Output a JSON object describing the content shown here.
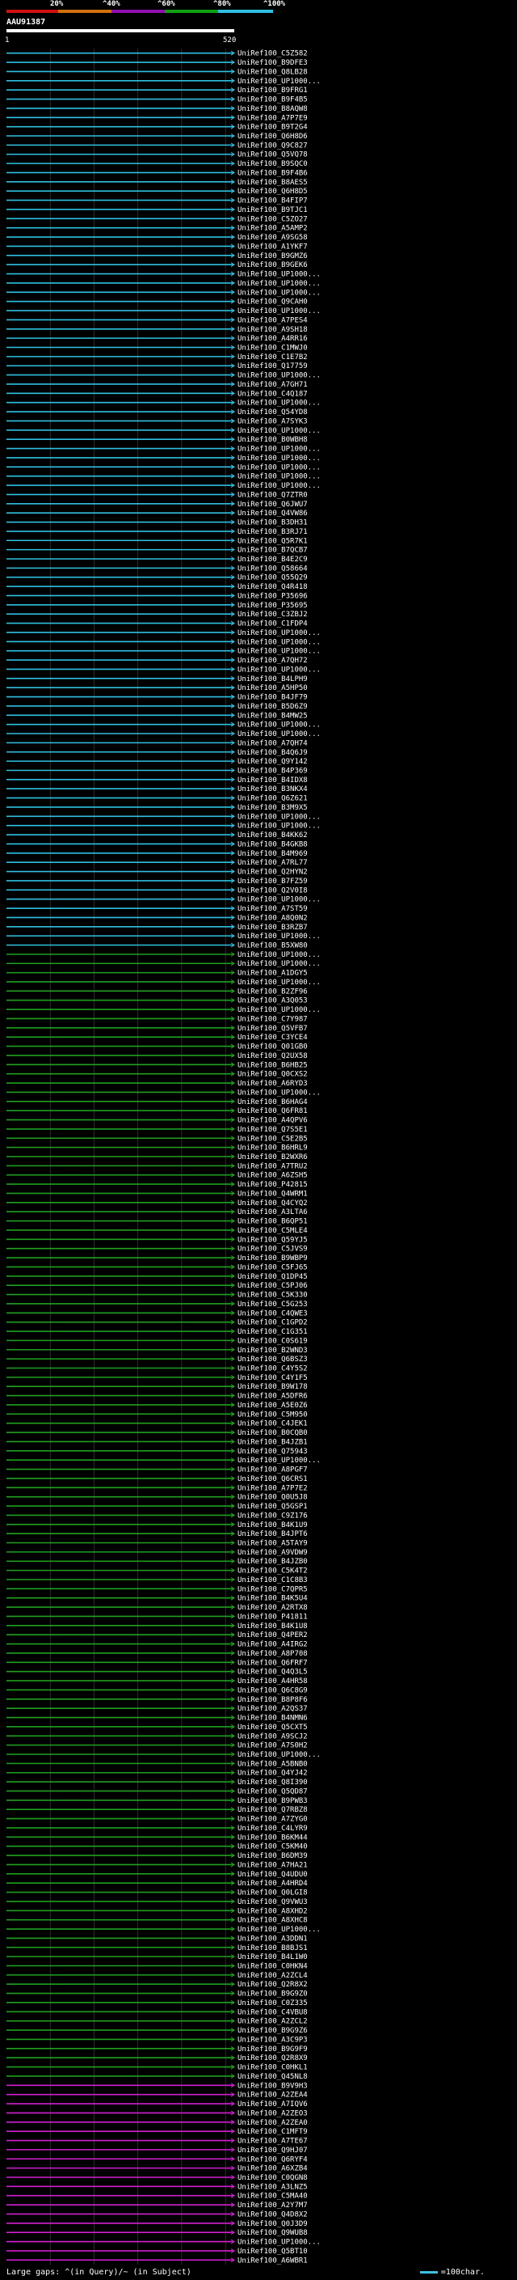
{
  "legend": {
    "ticks": [
      "20%",
      "^40%",
      "^60%",
      "^80%",
      "^100%"
    ],
    "colors": [
      "#d01010",
      "#d07010",
      "#9010b0",
      "#10a010",
      "#30c0e0"
    ]
  },
  "query": {
    "name": "AAU91387",
    "ruler_start": "1",
    "ruler_end": "520"
  },
  "footer": {
    "gaps": "Large gaps: ^(in Query)/~ (in Subject)",
    "scale": "=100char."
  },
  "chart_data": {
    "type": "alignment",
    "title": "AAU91387",
    "query_length": 520,
    "hits": [
      {
        "id": "UniRef100_C5Z582",
        "group": "cyan"
      },
      {
        "id": "UniRef100_B9DFE3",
        "group": "cyan"
      },
      {
        "id": "UniRef100_Q8LB28",
        "group": "cyan"
      },
      {
        "id": "UniRef100_UP1000...",
        "group": "cyan"
      },
      {
        "id": "UniRef100_B9FRG1",
        "group": "cyan"
      },
      {
        "id": "UniRef100_B9F4B5",
        "group": "cyan"
      },
      {
        "id": "UniRef100_B8AQW8",
        "group": "cyan"
      },
      {
        "id": "UniRef100_A7P7E9",
        "group": "cyan"
      },
      {
        "id": "UniRef100_B9T2G4",
        "group": "cyan"
      },
      {
        "id": "UniRef100_Q6H8D6",
        "group": "cyan"
      },
      {
        "id": "UniRef100_Q9C827",
        "group": "cyan"
      },
      {
        "id": "UniRef100_Q5VQ78",
        "group": "cyan"
      },
      {
        "id": "UniRef100_B9SQC0",
        "group": "cyan"
      },
      {
        "id": "UniRef100_B9F4B6",
        "group": "cyan"
      },
      {
        "id": "UniRef100_B8AES5",
        "group": "cyan"
      },
      {
        "id": "UniRef100_Q6H8D5",
        "group": "cyan"
      },
      {
        "id": "UniRef100_B4FIP7",
        "group": "cyan"
      },
      {
        "id": "UniRef100_B9TJC1",
        "group": "cyan"
      },
      {
        "id": "UniRef100_C5ZO27",
        "group": "cyan"
      },
      {
        "id": "UniRef100_A5AMP2",
        "group": "cyan"
      },
      {
        "id": "UniRef100_A9SG58",
        "group": "cyan"
      },
      {
        "id": "UniRef100_A1YKF7",
        "group": "cyan"
      },
      {
        "id": "UniRef100_B9GMZ6",
        "group": "cyan"
      },
      {
        "id": "UniRef100_B9GEK6",
        "group": "cyan"
      },
      {
        "id": "UniRef100_UP1000...",
        "group": "cyan"
      },
      {
        "id": "UniRef100_UP1000...",
        "group": "cyan"
      },
      {
        "id": "UniRef100_UP1000...",
        "group": "cyan"
      },
      {
        "id": "UniRef100_Q9CAH0",
        "group": "cyan"
      },
      {
        "id": "UniRef100_UP1000...",
        "group": "cyan"
      },
      {
        "id": "UniRef100_A7PES4",
        "group": "cyan"
      },
      {
        "id": "UniRef100_A9SH18",
        "group": "cyan"
      },
      {
        "id": "UniRef100_A4RR16",
        "group": "cyan"
      },
      {
        "id": "UniRef100_C1MWJ0",
        "group": "cyan"
      },
      {
        "id": "UniRef100_C1E7B2",
        "group": "cyan"
      },
      {
        "id": "UniRef100_Q17759",
        "group": "cyan"
      },
      {
        "id": "UniRef100_UP1000...",
        "group": "cyan"
      },
      {
        "id": "UniRef100_A7GH71",
        "group": "cyan"
      },
      {
        "id": "UniRef100_C4Q187",
        "group": "cyan"
      },
      {
        "id": "UniRef100_UP1000...",
        "group": "cyan"
      },
      {
        "id": "UniRef100_Q54YD8",
        "group": "cyan"
      },
      {
        "id": "UniRef100_A7SYK3",
        "group": "cyan"
      },
      {
        "id": "UniRef100_UP1000...",
        "group": "cyan"
      },
      {
        "id": "UniRef100_B0WBH8",
        "group": "cyan"
      },
      {
        "id": "UniRef100_UP1000...",
        "group": "cyan"
      },
      {
        "id": "UniRef100_UP1000...",
        "group": "cyan"
      },
      {
        "id": "UniRef100_UP1000...",
        "group": "cyan"
      },
      {
        "id": "UniRef100_UP1000...",
        "group": "cyan"
      },
      {
        "id": "UniRef100_UP1000...",
        "group": "cyan"
      },
      {
        "id": "UniRef100_Q7ZTR0",
        "group": "cyan"
      },
      {
        "id": "UniRef100_Q6JWU7",
        "group": "cyan"
      },
      {
        "id": "UniRef100_Q4VW86",
        "group": "cyan"
      },
      {
        "id": "UniRef100_B3DH31",
        "group": "cyan"
      },
      {
        "id": "UniRef100_B3RJ71",
        "group": "cyan"
      },
      {
        "id": "UniRef100_Q5R7K1",
        "group": "cyan"
      },
      {
        "id": "UniRef100_B7QCB7",
        "group": "cyan"
      },
      {
        "id": "UniRef100_B4E2C9",
        "group": "cyan"
      },
      {
        "id": "UniRef100_Q58664",
        "group": "cyan"
      },
      {
        "id": "UniRef100_Q55Q29",
        "group": "cyan"
      },
      {
        "id": "UniRef100_Q4R418",
        "group": "cyan"
      },
      {
        "id": "UniRef100_P35696",
        "group": "cyan"
      },
      {
        "id": "UniRef100_P35695",
        "group": "cyan"
      },
      {
        "id": "UniRef100_C3ZBJ2",
        "group": "cyan"
      },
      {
        "id": "UniRef100_C1FDP4",
        "group": "cyan"
      },
      {
        "id": "UniRef100_UP1000...",
        "group": "cyan"
      },
      {
        "id": "UniRef100_UP1000...",
        "group": "cyan"
      },
      {
        "id": "UniRef100_UP1000...",
        "group": "cyan"
      },
      {
        "id": "UniRef100_A7QH72",
        "group": "cyan"
      },
      {
        "id": "UniRef100_UP1000...",
        "group": "cyan"
      },
      {
        "id": "UniRef100_B4LPH9",
        "group": "cyan"
      },
      {
        "id": "UniRef100_A5HP50",
        "group": "cyan"
      },
      {
        "id": "UniRef100_B4JF79",
        "group": "cyan"
      },
      {
        "id": "UniRef100_B5D6Z9",
        "group": "cyan"
      },
      {
        "id": "UniRef100_B4MW25",
        "group": "cyan"
      },
      {
        "id": "UniRef100_UP1000...",
        "group": "cyan"
      },
      {
        "id": "UniRef100_UP1000...",
        "group": "cyan"
      },
      {
        "id": "UniRef100_A7QH74",
        "group": "cyan"
      },
      {
        "id": "UniRef100_B4Q6J9",
        "group": "cyan"
      },
      {
        "id": "UniRef100_Q9Y142",
        "group": "cyan"
      },
      {
        "id": "UniRef100_B4P369",
        "group": "cyan"
      },
      {
        "id": "UniRef100_B4IDX8",
        "group": "cyan"
      },
      {
        "id": "UniRef100_B3NKX4",
        "group": "cyan"
      },
      {
        "id": "UniRef100_Q6Z621",
        "group": "cyan"
      },
      {
        "id": "UniRef100_B3M9X5",
        "group": "cyan"
      },
      {
        "id": "UniRef100_UP1000...",
        "group": "cyan"
      },
      {
        "id": "UniRef100_UP1000...",
        "group": "cyan"
      },
      {
        "id": "UniRef100_B4KK62",
        "group": "cyan"
      },
      {
        "id": "UniRef100_B4GKB8",
        "group": "cyan"
      },
      {
        "id": "UniRef100_B4M969",
        "group": "cyan"
      },
      {
        "id": "UniRef100_A7RL77",
        "group": "cyan"
      },
      {
        "id": "UniRef100_Q2HYN2",
        "group": "cyan"
      },
      {
        "id": "UniRef100_B7FZ59",
        "group": "cyan"
      },
      {
        "id": "UniRef100_Q2V0I8",
        "group": "cyan"
      },
      {
        "id": "UniRef100_UP1000...",
        "group": "cyan"
      },
      {
        "id": "UniRef100_A7ST59",
        "group": "cyan"
      },
      {
        "id": "UniRef100_A8Q0N2",
        "group": "cyan"
      },
      {
        "id": "UniRef100_B3RZB7",
        "group": "cyan"
      },
      {
        "id": "UniRef100_UP1000...",
        "group": "cyan"
      },
      {
        "id": "UniRef100_B5XW80",
        "group": "cyan"
      },
      {
        "id": "UniRef100_UP1000...",
        "group": "green"
      },
      {
        "id": "UniRef100_UP1000...",
        "group": "green"
      },
      {
        "id": "UniRef100_A1DGY5",
        "group": "green"
      },
      {
        "id": "UniRef100_UP1000...",
        "group": "green"
      },
      {
        "id": "UniRef100_B2ZF96",
        "group": "green"
      },
      {
        "id": "UniRef100_A3Q053",
        "group": "green"
      },
      {
        "id": "UniRef100_UP1000...",
        "group": "green"
      },
      {
        "id": "UniRef100_C7Y987",
        "group": "green"
      },
      {
        "id": "UniRef100_Q5VFB7",
        "group": "green"
      },
      {
        "id": "UniRef100_C3YCE4",
        "group": "green"
      },
      {
        "id": "UniRef100_Q01GB0",
        "group": "green"
      },
      {
        "id": "UniRef100_Q2UX58",
        "group": "green"
      },
      {
        "id": "UniRef100_B6HB25",
        "group": "green"
      },
      {
        "id": "UniRef100_Q0CXS2",
        "group": "green"
      },
      {
        "id": "UniRef100_A6RYD3",
        "group": "green"
      },
      {
        "id": "UniRef100_UP1000...",
        "group": "green"
      },
      {
        "id": "UniRef100_B6HAG4",
        "group": "green"
      },
      {
        "id": "UniRef100_Q6FR81",
        "group": "green"
      },
      {
        "id": "UniRef100_A4QPV6",
        "group": "green"
      },
      {
        "id": "UniRef100_Q7S5E1",
        "group": "green"
      },
      {
        "id": "UniRef100_C5E2B5",
        "group": "green"
      },
      {
        "id": "UniRef100_B6HRL9",
        "group": "green"
      },
      {
        "id": "UniRef100_B2WXR6",
        "group": "green"
      },
      {
        "id": "UniRef100_A7TRU2",
        "group": "green"
      },
      {
        "id": "UniRef100_A6ZSH5",
        "group": "green"
      },
      {
        "id": "UniRef100_P42815",
        "group": "green"
      },
      {
        "id": "UniRef100_Q4WRM1",
        "group": "green"
      },
      {
        "id": "UniRef100_Q4CYQ2",
        "group": "green"
      },
      {
        "id": "UniRef100_A3LTA6",
        "group": "green"
      },
      {
        "id": "UniRef100_B6QP51",
        "group": "green"
      },
      {
        "id": "UniRef100_C5MLE4",
        "group": "green"
      },
      {
        "id": "UniRef100_Q59YJ5",
        "group": "green"
      },
      {
        "id": "UniRef100_C5JVS9",
        "group": "green"
      },
      {
        "id": "UniRef100_B9WBP9",
        "group": "green"
      },
      {
        "id": "UniRef100_C5FJ65",
        "group": "green"
      },
      {
        "id": "UniRef100_Q1DP45",
        "group": "green"
      },
      {
        "id": "UniRef100_C5PJ06",
        "group": "green"
      },
      {
        "id": "UniRef100_C5K330",
        "group": "green"
      },
      {
        "id": "UniRef100_C5G253",
        "group": "green"
      },
      {
        "id": "UniRef100_C4QWE3",
        "group": "green"
      },
      {
        "id": "UniRef100_C1GPD2",
        "group": "green"
      },
      {
        "id": "UniRef100_C1G351",
        "group": "green"
      },
      {
        "id": "UniRef100_C0S619",
        "group": "green"
      },
      {
        "id": "UniRef100_B2WND3",
        "group": "green"
      },
      {
        "id": "UniRef100_Q6BSZ3",
        "group": "green"
      },
      {
        "id": "UniRef100_C4Y5S2",
        "group": "green"
      },
      {
        "id": "UniRef100_C4Y1F5",
        "group": "green"
      },
      {
        "id": "UniRef100_B9W178",
        "group": "green"
      },
      {
        "id": "UniRef100_A5DFR6",
        "group": "green"
      },
      {
        "id": "UniRef100_A5E0Z6",
        "group": "green"
      },
      {
        "id": "UniRef100_C5M950",
        "group": "green"
      },
      {
        "id": "UniRef100_C4JEK1",
        "group": "green"
      },
      {
        "id": "UniRef100_B0CQB0",
        "group": "green"
      },
      {
        "id": "UniRef100_B4JZB1",
        "group": "green"
      },
      {
        "id": "UniRef100_Q75943",
        "group": "green"
      },
      {
        "id": "UniRef100_UP1000...",
        "group": "green"
      },
      {
        "id": "UniRef100_A8PGF7",
        "group": "green"
      },
      {
        "id": "UniRef100_Q6CRS1",
        "group": "green"
      },
      {
        "id": "UniRef100_A7P7E2",
        "group": "green"
      },
      {
        "id": "UniRef100_Q0U5J8",
        "group": "green"
      },
      {
        "id": "UniRef100_Q5GSP1",
        "group": "green"
      },
      {
        "id": "UniRef100_C9Z176",
        "group": "green"
      },
      {
        "id": "UniRef100_B4K1U9",
        "group": "green"
      },
      {
        "id": "UniRef100_B4JPT6",
        "group": "green"
      },
      {
        "id": "UniRef100_A5TAY9",
        "group": "green"
      },
      {
        "id": "UniRef100_A9VDW9",
        "group": "green"
      },
      {
        "id": "UniRef100_B4JZB0",
        "group": "green"
      },
      {
        "id": "UniRef100_C5K4T2",
        "group": "green"
      },
      {
        "id": "UniRef100_C1C8B3",
        "group": "green"
      },
      {
        "id": "UniRef100_C7QPR5",
        "group": "green"
      },
      {
        "id": "UniRef100_B4K5U4",
        "group": "green"
      },
      {
        "id": "UniRef100_A2RTX8",
        "group": "green"
      },
      {
        "id": "UniRef100_P41811",
        "group": "green"
      },
      {
        "id": "UniRef100_B4K1U8",
        "group": "green"
      },
      {
        "id": "UniRef100_Q4PER2",
        "group": "green"
      },
      {
        "id": "UniRef100_A4IRG2",
        "group": "green"
      },
      {
        "id": "UniRef100_A8P708",
        "group": "green"
      },
      {
        "id": "UniRef100_Q6FRF7",
        "group": "green"
      },
      {
        "id": "UniRef100_Q4Q3L5",
        "group": "green"
      },
      {
        "id": "UniRef100_A4HR58",
        "group": "green"
      },
      {
        "id": "UniRef100_Q6C8G9",
        "group": "green"
      },
      {
        "id": "UniRef100_B8P8F6",
        "group": "green"
      },
      {
        "id": "UniRef100_A2QS37",
        "group": "green"
      },
      {
        "id": "UniRef100_B4NMN6",
        "group": "green"
      },
      {
        "id": "UniRef100_Q5CXT5",
        "group": "green"
      },
      {
        "id": "UniRef100_A9SCJ2",
        "group": "green"
      },
      {
        "id": "UniRef100_A7S0H2",
        "group": "green"
      },
      {
        "id": "UniRef100_UP1000...",
        "group": "green"
      },
      {
        "id": "UniRef100_A5BNB0",
        "group": "green"
      },
      {
        "id": "UniRef100_Q4YJ42",
        "group": "green"
      },
      {
        "id": "UniRef100_Q8I390",
        "group": "green"
      },
      {
        "id": "UniRef100_Q5QD87",
        "group": "green"
      },
      {
        "id": "UniRef100_B9PWB3",
        "group": "green"
      },
      {
        "id": "UniRef100_Q7RBZ8",
        "group": "green"
      },
      {
        "id": "UniRef100_A7ZYG0",
        "group": "green"
      },
      {
        "id": "UniRef100_C4LYR9",
        "group": "green"
      },
      {
        "id": "UniRef100_B6KM44",
        "group": "green"
      },
      {
        "id": "UniRef100_C5KM40",
        "group": "green"
      },
      {
        "id": "UniRef100_B6DM39",
        "group": "green"
      },
      {
        "id": "UniRef100_A7HA21",
        "group": "green"
      },
      {
        "id": "UniRef100_Q4UDU0",
        "group": "green"
      },
      {
        "id": "UniRef100_A4HRD4",
        "group": "green"
      },
      {
        "id": "UniRef100_Q0LGI8",
        "group": "green"
      },
      {
        "id": "UniRef100_Q9VWU3",
        "group": "green"
      },
      {
        "id": "UniRef100_A8XHD2",
        "group": "green"
      },
      {
        "id": "UniRef100_A8XHC8",
        "group": "green"
      },
      {
        "id": "UniRef100_UP1000...",
        "group": "green"
      },
      {
        "id": "UniRef100_A3DDN1",
        "group": "green"
      },
      {
        "id": "UniRef100_B8BJS1",
        "group": "green"
      },
      {
        "id": "UniRef100_B4L1W0",
        "group": "green"
      },
      {
        "id": "UniRef100_C0HKN4",
        "group": "green"
      },
      {
        "id": "UniRef100_A2ZCL4",
        "group": "green"
      },
      {
        "id": "UniRef100_Q2R8X2",
        "group": "green"
      },
      {
        "id": "UniRef100_B9G9Z0",
        "group": "green"
      },
      {
        "id": "UniRef100_C0Z335",
        "group": "green"
      },
      {
        "id": "UniRef100_C4VBU8",
        "group": "green"
      },
      {
        "id": "UniRef100_A2ZCL2",
        "group": "green"
      },
      {
        "id": "UniRef100_B9G9Z6",
        "group": "green"
      },
      {
        "id": "UniRef100_A3C9P3",
        "group": "green"
      },
      {
        "id": "UniRef100_B9G9F9",
        "group": "green"
      },
      {
        "id": "UniRef100_Q2R8X9",
        "group": "green"
      },
      {
        "id": "UniRef100_C0HKL1",
        "group": "green"
      },
      {
        "id": "UniRef100_Q45NL8",
        "group": "green"
      },
      {
        "id": "UniRef100_B9V9H3",
        "group": "magenta"
      },
      {
        "id": "UniRef100_A2ZEA4",
        "group": "magenta"
      },
      {
        "id": "UniRef100_A7IQV6",
        "group": "magenta"
      },
      {
        "id": "UniRef100_A2ZEO3",
        "group": "magenta"
      },
      {
        "id": "UniRef100_A2ZEA0",
        "group": "magenta"
      },
      {
        "id": "UniRef100_C1MFT9",
        "group": "magenta"
      },
      {
        "id": "UniRef100_A7TE67",
        "group": "magenta"
      },
      {
        "id": "UniRef100_Q9HJ07",
        "group": "magenta"
      },
      {
        "id": "UniRef100_Q6RYF4",
        "group": "magenta"
      },
      {
        "id": "UniRef100_A6XZB4",
        "group": "magenta"
      },
      {
        "id": "UniRef100_C0QGN8",
        "group": "magenta"
      },
      {
        "id": "UniRef100_A3LNZ5",
        "group": "magenta"
      },
      {
        "id": "UniRef100_C5MA40",
        "group": "magenta"
      },
      {
        "id": "UniRef100_A2Y7M7",
        "group": "magenta"
      },
      {
        "id": "UniRef100_Q4D8X2",
        "group": "magenta"
      },
      {
        "id": "UniRef100_Q0J3D9",
        "group": "magenta"
      },
      {
        "id": "UniRef100_Q9WUB8",
        "group": "magenta"
      },
      {
        "id": "UniRef100_UP1000...",
        "group": "magenta"
      },
      {
        "id": "UniRef100_Q5BT10",
        "group": "magenta"
      },
      {
        "id": "UniRef100_A6WBR1",
        "group": "magenta"
      }
    ]
  }
}
